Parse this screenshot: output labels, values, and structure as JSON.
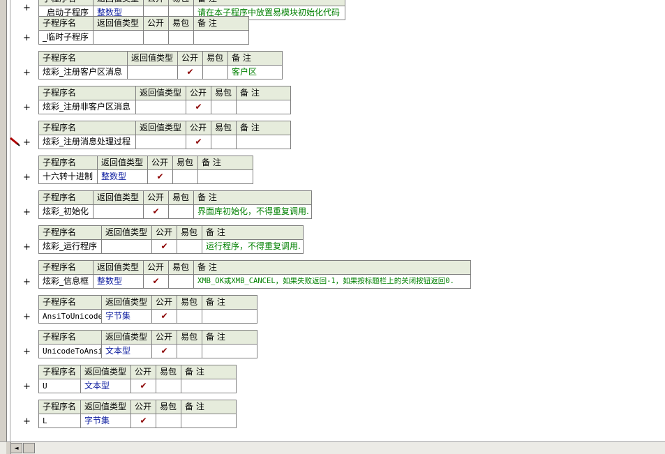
{
  "headers": {
    "name": "子程序名",
    "ret": "返回值类型",
    "pub": "公开",
    "easy": "易包",
    "remark": "备 注"
  },
  "expand_glyph": "+",
  "check_glyph": "✔",
  "subroutines": [
    {
      "name": "_启动子程序",
      "ret": "整数型",
      "public": false,
      "easy": false,
      "remark": "请在本子程序中放置易模块初始化代码"
    },
    {
      "name": "_临时子程序",
      "ret": "",
      "public": false,
      "easy": false,
      "remark": ""
    },
    {
      "name": "炫彩_注册客户区消息",
      "ret": "",
      "public": true,
      "easy": false,
      "remark": "客户区"
    },
    {
      "name": "炫彩_注册非客户区消息",
      "ret": "",
      "public": true,
      "easy": false,
      "remark": ""
    },
    {
      "name": "炫彩_注册消息处理过程",
      "ret": "",
      "public": true,
      "easy": false,
      "remark": ""
    },
    {
      "name": "十六转十进制",
      "ret": "整数型",
      "public": true,
      "easy": false,
      "remark": ""
    },
    {
      "name": "炫彩_初始化",
      "ret": "",
      "public": true,
      "easy": false,
      "remark": "界面库初始化，不得重复调用."
    },
    {
      "name": "炫彩_运行程序",
      "ret": "",
      "public": true,
      "easy": false,
      "remark": "运行程序，不得重复调用."
    },
    {
      "name": "炫彩_信息框",
      "ret": "整数型",
      "public": true,
      "easy": false,
      "remark": "XMB_OK或XMB_CANCEL，如果失败返回-1，如果按标题栏上的关闭按钮返回0."
    },
    {
      "name": "AnsiToUnicode",
      "ret": "字节集",
      "public": true,
      "easy": false,
      "remark": ""
    },
    {
      "name": "UnicodeToAnsi",
      "ret": "文本型",
      "public": true,
      "easy": false,
      "remark": ""
    },
    {
      "name": "U",
      "ret": "文本型",
      "public": true,
      "easy": false,
      "remark": ""
    },
    {
      "name": "L",
      "ret": "字节集",
      "public": true,
      "easy": false,
      "remark": ""
    }
  ],
  "scrollbar": {
    "left_arrow": "◄"
  }
}
